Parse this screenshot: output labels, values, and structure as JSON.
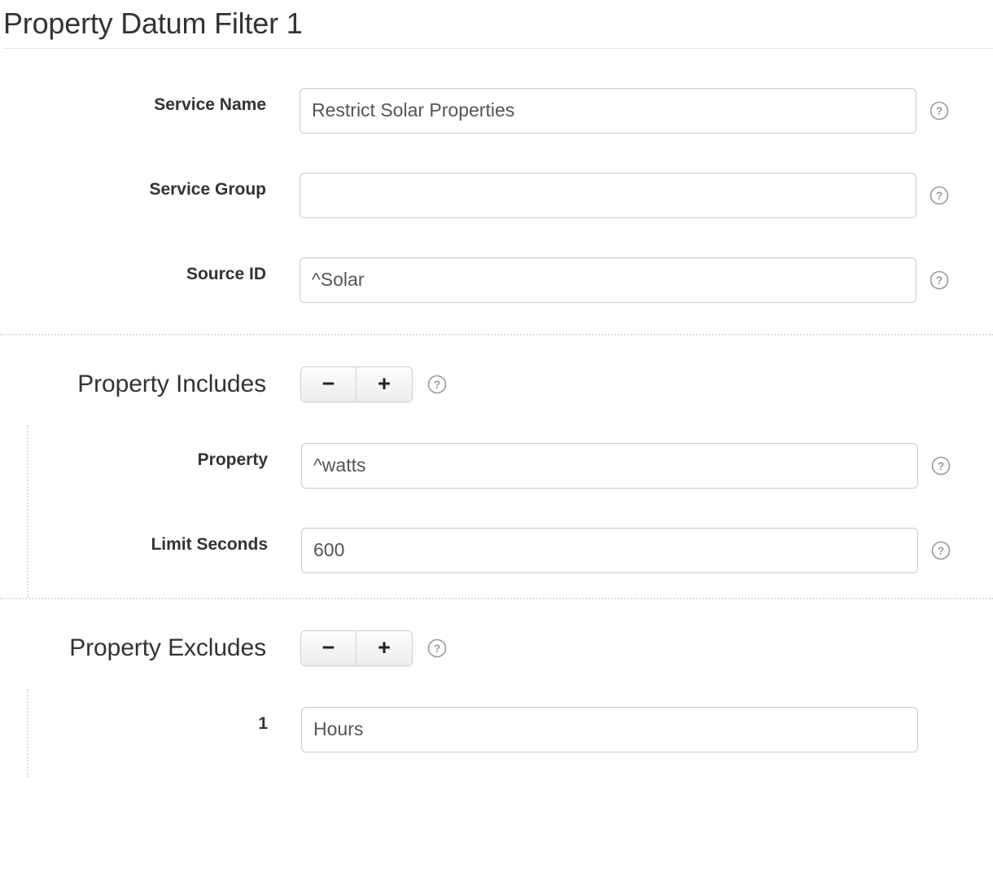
{
  "page": {
    "title": "Property Datum Filter 1"
  },
  "icons": {
    "help": "help-circle-icon",
    "minus": "minus-icon",
    "plus": "plus-icon"
  },
  "colors": {
    "text": "#333333",
    "input_text": "#555555",
    "border": "#cccccc",
    "dotted": "#dedede",
    "rule": "#e7e7e7"
  },
  "fields": [
    {
      "label": "Service Name",
      "value": "Restrict Solar Properties",
      "placeholder": "",
      "help": "?"
    },
    {
      "label": "Service Group",
      "value": "",
      "placeholder": "",
      "help": "?"
    },
    {
      "label": "Source ID",
      "value": "^Solar",
      "placeholder": "",
      "help": "?"
    }
  ],
  "groups": [
    {
      "title": "Property Includes",
      "remove_label": "−",
      "add_label": "+",
      "help": "?",
      "items": [
        {
          "label": "Property",
          "value": "^watts",
          "placeholder": "",
          "help": "?"
        },
        {
          "label": "Limit Seconds",
          "value": "600",
          "placeholder": "",
          "help": "?"
        }
      ]
    },
    {
      "title": "Property Excludes",
      "remove_label": "−",
      "add_label": "+",
      "help": "?",
      "items": [
        {
          "label": "1",
          "value": "Hours",
          "placeholder": "",
          "help": ""
        }
      ]
    }
  ]
}
